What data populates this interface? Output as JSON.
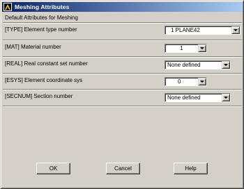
{
  "window": {
    "title": "Meshing Attributes",
    "section_title": "Default Attributes for Meshing"
  },
  "rows": [
    {
      "label": "[TYPE]  Element type number",
      "value": "1    PLANE42"
    },
    {
      "label": "[MAT]   Material number",
      "value": "1"
    },
    {
      "label": "[REAL]  Real constant set number",
      "value": "None defined"
    },
    {
      "label": "[ESYS]  Element coordinate sys",
      "value": "0"
    },
    {
      "label": "[SECNUM]  Section number",
      "value": "None defined"
    }
  ],
  "buttons": {
    "ok": "OK",
    "cancel": "Cancel",
    "help": "Help"
  }
}
